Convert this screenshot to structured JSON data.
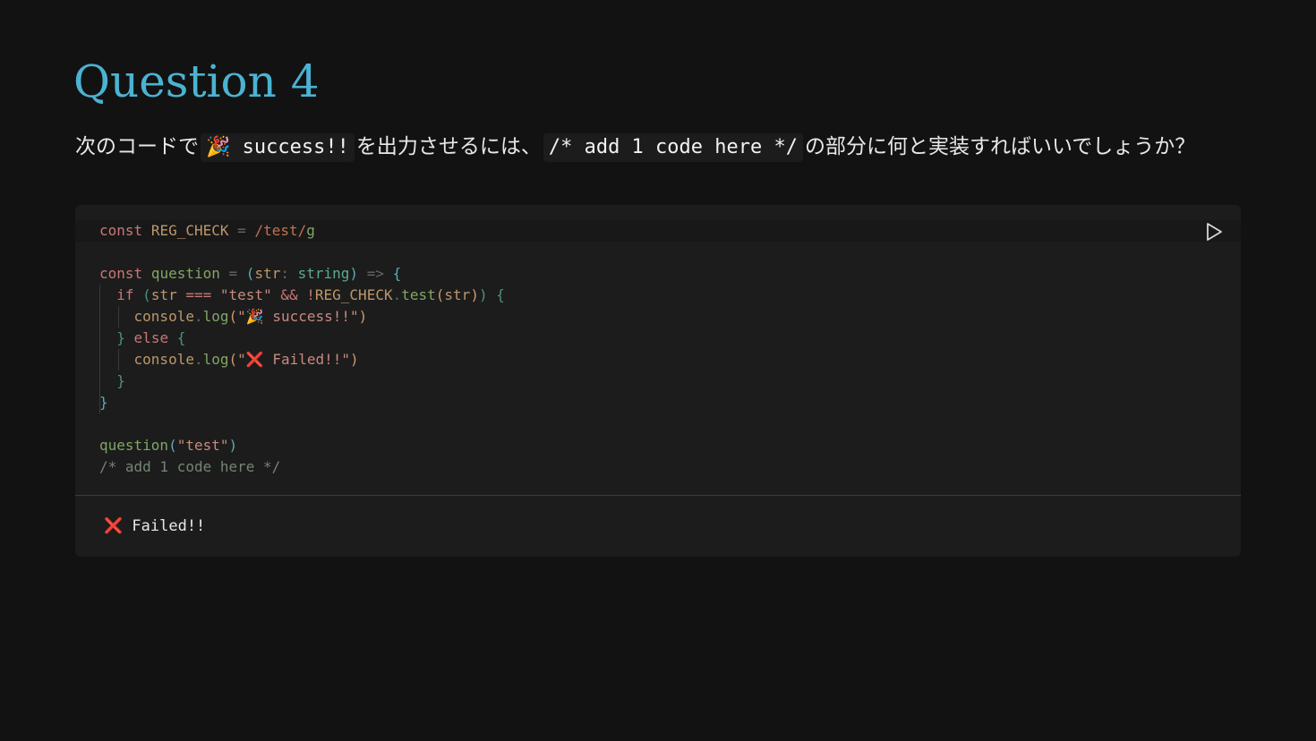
{
  "page": {
    "title": "Question 4",
    "question": {
      "part1": "次のコードで",
      "code1": "🎉 success!!",
      "part2": "を出力させるには、",
      "code2": "/* add 1 code here */",
      "part3": "の部分に何と実装すればいいでしょうか？"
    }
  },
  "editor": {
    "run_icon": "play-icon",
    "lines": [
      {
        "segments": [
          {
            "t": "const",
            "c": "kw"
          },
          {
            "t": " "
          },
          {
            "t": "REG_CHECK",
            "c": "var"
          },
          {
            "t": " "
          },
          {
            "t": "=",
            "c": "op"
          },
          {
            "t": " "
          },
          {
            "t": "/test/",
            "c": "rx"
          },
          {
            "t": "g",
            "c": "fn"
          }
        ]
      },
      {
        "segments": []
      },
      {
        "segments": [
          {
            "t": "const",
            "c": "kw"
          },
          {
            "t": " "
          },
          {
            "t": "question",
            "c": "fn"
          },
          {
            "t": " "
          },
          {
            "t": "=",
            "c": "op"
          },
          {
            "t": " "
          },
          {
            "t": "(",
            "c": "p1"
          },
          {
            "t": "str",
            "c": "var"
          },
          {
            "t": ":",
            "c": "op"
          },
          {
            "t": " "
          },
          {
            "t": "string",
            "c": "typ"
          },
          {
            "t": ")",
            "c": "p1"
          },
          {
            "t": " "
          },
          {
            "t": "=>",
            "c": "op"
          },
          {
            "t": " "
          },
          {
            "t": "{",
            "c": "p1"
          }
        ]
      },
      {
        "segments": [
          {
            "t": "  "
          },
          {
            "t": "if",
            "c": "kw"
          },
          {
            "t": " "
          },
          {
            "t": "(",
            "c": "p2"
          },
          {
            "t": "str",
            "c": "var"
          },
          {
            "t": " "
          },
          {
            "t": "===",
            "c": "kw"
          },
          {
            "t": " "
          },
          {
            "t": "\"test\"",
            "c": "str"
          },
          {
            "t": " "
          },
          {
            "t": "&&",
            "c": "kw"
          },
          {
            "t": " "
          },
          {
            "t": "!",
            "c": "kw"
          },
          {
            "t": "REG_CHECK",
            "c": "var"
          },
          {
            "t": ".",
            "c": "op"
          },
          {
            "t": "test",
            "c": "fn"
          },
          {
            "t": "(",
            "c": "p3"
          },
          {
            "t": "str",
            "c": "var"
          },
          {
            "t": ")",
            "c": "p3"
          },
          {
            "t": ")",
            "c": "p2"
          },
          {
            "t": " "
          },
          {
            "t": "{",
            "c": "p2"
          }
        ]
      },
      {
        "segments": [
          {
            "t": "    "
          },
          {
            "t": "console",
            "c": "var"
          },
          {
            "t": ".",
            "c": "op"
          },
          {
            "t": "log",
            "c": "fn"
          },
          {
            "t": "(",
            "c": "p3"
          },
          {
            "t": "\"🎉 success!!\"",
            "c": "str"
          },
          {
            "t": ")",
            "c": "p3"
          }
        ]
      },
      {
        "segments": [
          {
            "t": "  "
          },
          {
            "t": "}",
            "c": "p2"
          },
          {
            "t": " "
          },
          {
            "t": "else",
            "c": "kw"
          },
          {
            "t": " "
          },
          {
            "t": "{",
            "c": "p2"
          }
        ]
      },
      {
        "segments": [
          {
            "t": "    "
          },
          {
            "t": "console",
            "c": "var"
          },
          {
            "t": ".",
            "c": "op"
          },
          {
            "t": "log",
            "c": "fn"
          },
          {
            "t": "(",
            "c": "p3"
          },
          {
            "t": "\"",
            "c": "str"
          },
          {
            "t": "❌",
            "c": "cx"
          },
          {
            "t": " Failed!!\"",
            "c": "str"
          },
          {
            "t": ")",
            "c": "p3"
          }
        ]
      },
      {
        "segments": [
          {
            "t": "  "
          },
          {
            "t": "}",
            "c": "p2"
          }
        ]
      },
      {
        "segments": [
          {
            "t": "}",
            "c": "p1"
          }
        ]
      },
      {
        "segments": []
      },
      {
        "segments": [
          {
            "t": "question",
            "c": "fn"
          },
          {
            "t": "(",
            "c": "p1"
          },
          {
            "t": "\"test\"",
            "c": "str"
          },
          {
            "t": ")",
            "c": "p1"
          }
        ]
      },
      {
        "segments": [
          {
            "t": "/* add 1 code here */",
            "c": "cm"
          }
        ]
      }
    ]
  },
  "output": {
    "icon": "❌",
    "text": " Failed!!"
  }
}
